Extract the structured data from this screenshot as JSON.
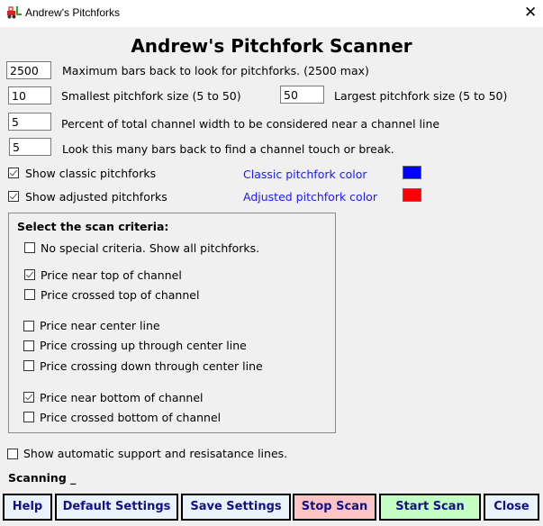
{
  "window": {
    "title": "Andrew's Pitchforks",
    "app_icon": "forklift-icon",
    "close_icon": "close-icon"
  },
  "heading": "Andrew's Pitchfork Scanner",
  "settings": {
    "max_bars": {
      "value": "2500",
      "label": "Maximum bars back to look for pitchforks.  (2500 max)"
    },
    "smallest_size": {
      "value": "10",
      "label": "Smallest pitchfork size  (5 to 50)"
    },
    "largest_size": {
      "value": "50",
      "label": "Largest pitchfork size  (5 to 50)"
    },
    "percent_near": {
      "value": "5",
      "label": "Percent of total channel width to be considered near a channel line"
    },
    "bars_back_touch": {
      "value": "5",
      "label": "Look this many bars back to find a channel touch or break."
    }
  },
  "display": {
    "show_classic": {
      "label": "Show classic pitchforks",
      "checked": true
    },
    "show_adjusted": {
      "label": "Show adjusted pitchforks",
      "checked": true
    },
    "classic_color": {
      "label": "Classic pitchfork color",
      "color": "#0000ff"
    },
    "adjusted_color": {
      "label": "Adjusted pitchfork color",
      "color": "#ff0000"
    }
  },
  "criteria": {
    "title": "Select the scan criteria:",
    "items": [
      {
        "label": "No special criteria.   Show all pitchforks.",
        "checked": false
      },
      {
        "label": "Price near top of channel",
        "checked": true
      },
      {
        "label": "Price crossed top of channel",
        "checked": false
      },
      {
        "label": "Price near center line",
        "checked": false
      },
      {
        "label": "Price crossing up through center line",
        "checked": false
      },
      {
        "label": "Price crossing down through center line",
        "checked": false
      },
      {
        "label": "Price near bottom of channel",
        "checked": true
      },
      {
        "label": "Price crossed bottom of channel",
        "checked": false
      }
    ]
  },
  "auto_lines": {
    "label": "Show automatic support and resisatance lines.",
    "checked": false
  },
  "status": "Scanning _",
  "buttons": {
    "help": {
      "label": "Help",
      "color": "#eaf2fc"
    },
    "default_settings": {
      "label": "Default Settings",
      "color": "#eaf2fc"
    },
    "save_settings": {
      "label": "Save Settings",
      "color": "#eaf2fc"
    },
    "stop_scan": {
      "label": "Stop Scan",
      "color": "#ffc4c4"
    },
    "start_scan": {
      "label": "Start Scan",
      "color": "#c4ffc4"
    },
    "close": {
      "label": "Close",
      "color": "#eaf2fc"
    }
  }
}
